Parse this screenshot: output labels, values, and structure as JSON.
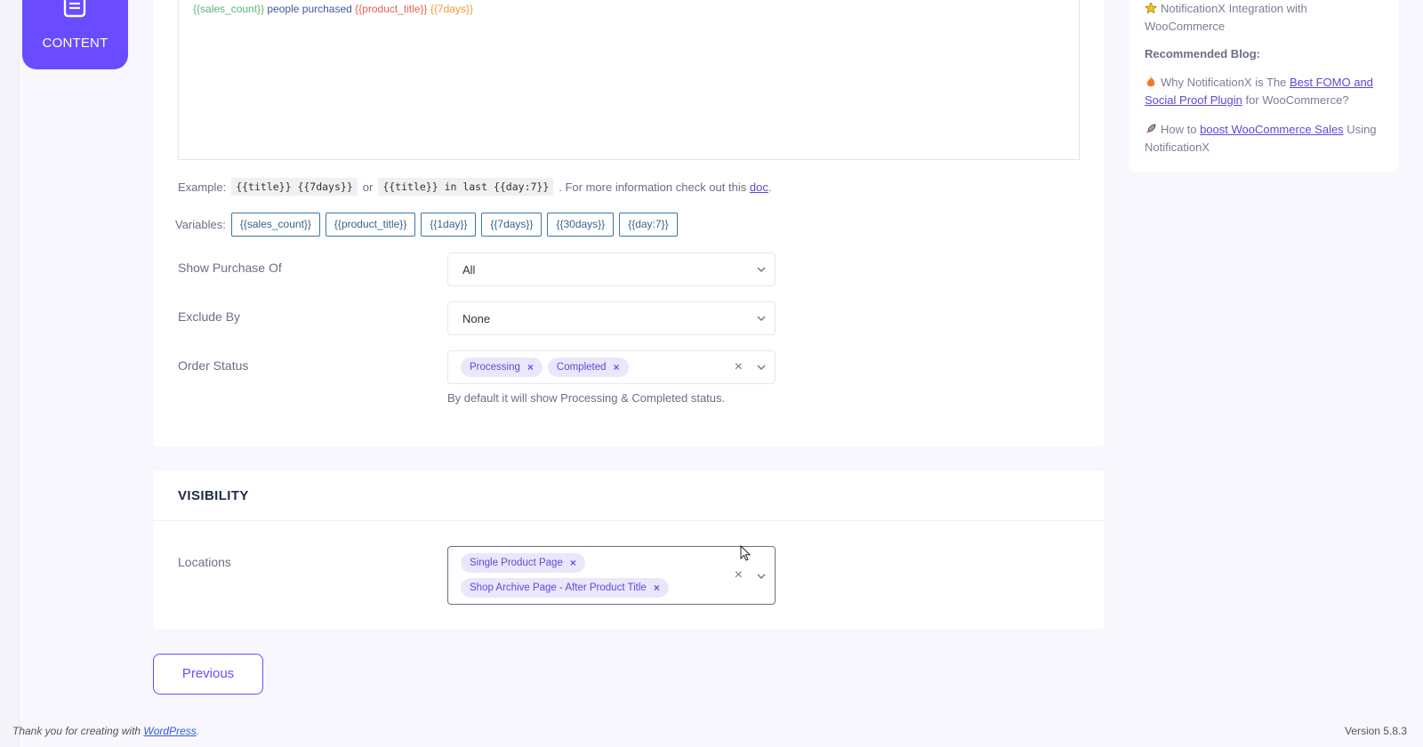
{
  "nav": {
    "content_label": "CONTENT"
  },
  "template": {
    "parts": [
      {
        "text": "{{sales_count}}",
        "color": "#5fb37a"
      },
      {
        "text": " people purchased ",
        "color": "#3d5a9e"
      },
      {
        "text": "{{product_title}}",
        "color": "#e0664f"
      },
      {
        "text": " {{7days}}",
        "color": "#ea9b3a"
      }
    ]
  },
  "example": {
    "prefix": "Example:",
    "code1": "{{title}} {{7days}}",
    "or": "or",
    "code2": "{{title}} in last {{day:7}}",
    "suffix": ". For more information check out this",
    "link": "doc",
    "end": "."
  },
  "variables": {
    "label": "Variables:",
    "chips": [
      "{{sales_count}}",
      "{{product_title}}",
      "{{1day}}",
      "{{7days}}",
      "{{30days}}",
      "{{day:7}}"
    ]
  },
  "fields": {
    "show_purchase_of": {
      "label": "Show Purchase Of",
      "value": "All"
    },
    "exclude_by": {
      "label": "Exclude By",
      "value": "None"
    },
    "order_status": {
      "label": "Order Status",
      "tags": [
        "Processing",
        "Completed"
      ],
      "help": "By default it will show Processing & Completed status."
    }
  },
  "visibility": {
    "heading": "VISIBILITY",
    "locations": {
      "label": "Locations",
      "tags": [
        "Single Product Page",
        "Shop Archive Page - After Product Title"
      ]
    }
  },
  "buttons": {
    "previous": "Previous"
  },
  "sidebar": {
    "integration": "NotificationX Integration with WooCommerce",
    "recommended_heading": "Recommended Blog:",
    "blog1_prefix": "Why NotificationX is The ",
    "blog1_link": "Best FOMO and Social Proof Plugin",
    "blog1_suffix": " for WooCommerce?",
    "blog2_prefix": "How to ",
    "blog2_link": "boost WooCommerce Sales",
    "blog2_suffix": " Using NotificationX"
  },
  "footer": {
    "thanks_prefix": "Thank you for creating with ",
    "thanks_link": "WordPress",
    "thanks_suffix": ".",
    "version": "Version 5.8.3"
  },
  "colors": {
    "accent": "#6a4bff",
    "tag_bg": "#ebe7fb",
    "chip_border": "#3d77a8"
  },
  "icons": {
    "nav": "document-icon",
    "tag_remove": "close-icon",
    "select": "chevron-down-icon"
  }
}
